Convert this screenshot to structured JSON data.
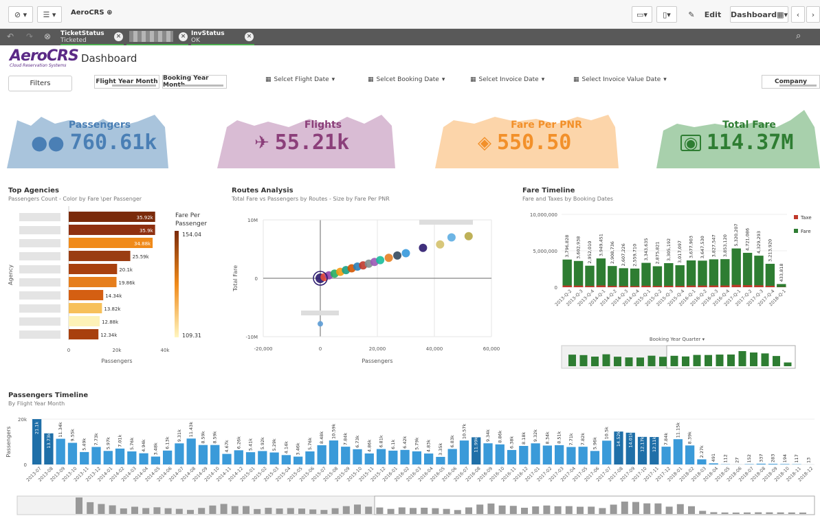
{
  "toolbar": {
    "app_name": "AeroCRS",
    "edit_label": "Edit",
    "sheet_label": "Dashboard"
  },
  "selections": [
    {
      "title": "TicketStatus",
      "value": "Ticketed"
    },
    {
      "title": "",
      "value": ""
    },
    {
      "title": "InvStatus",
      "value": "OK"
    }
  ],
  "header": {
    "logo_text": "AeroCRS",
    "logo_sub": "Cloud Reservation Systems",
    "title": "Dashboard",
    "filters_label": "Filters",
    "flight_year_month": "Flight Year Month",
    "booking_year_month": "Booking Year Month",
    "date_selectors": [
      "Selcet Flight Date",
      "Selcet Booking Date",
      "Selcet Invoice Date",
      "Select Invoice Value Date"
    ],
    "company_label": "Company"
  },
  "kpis": [
    {
      "label": "Passengers",
      "value": "760.61k",
      "icon": "people-icon",
      "color": "#4a7fb5",
      "fill": "#a9c4dc"
    },
    {
      "label": "Flights",
      "value": "55.21k",
      "icon": "plane-icon",
      "color": "#8b3f7a",
      "fill": "#d9bcd4"
    },
    {
      "label": "Fare Per PNR",
      "value": "550.50",
      "icon": "ticket-icon",
      "color": "#f2902a",
      "fill": "#fcd5aa"
    },
    {
      "label": "Total Fare",
      "value": "114.37M",
      "icon": "money-icon",
      "color": "#2e7d32",
      "fill": "#a8d0ac"
    }
  ],
  "top_agencies": {
    "title": "Top Agencies",
    "subtitle": "Passengers Count - Color by Fare \\per Passenger",
    "ylabel": "Agency",
    "xlabel": "Passengers",
    "legend_title": "Fare Per Passenger",
    "legend_max": "154.04",
    "legend_min": "109.31",
    "x_ticks": [
      "0",
      "20k",
      "40k"
    ],
    "bars": [
      {
        "label": "35.92k",
        "value": 35.92,
        "color": "#7a2a0a"
      },
      {
        "label": "35.9k",
        "value": 35.9,
        "color": "#8f3010"
      },
      {
        "label": "34.88k",
        "value": 34.88,
        "color": "#f08a1a"
      },
      {
        "label": "25.59k",
        "value": 25.59,
        "color": "#9a3d12"
      },
      {
        "label": "20.1k",
        "value": 20.1,
        "color": "#a8400e"
      },
      {
        "label": "19.86k",
        "value": 19.86,
        "color": "#e67e1c"
      },
      {
        "label": "14.34k",
        "value": 14.34,
        "color": "#d45f12"
      },
      {
        "label": "13.82k",
        "value": 13.82,
        "color": "#f7c05a"
      },
      {
        "label": "12.88k",
        "value": 12.88,
        "color": "#fdf2b8"
      },
      {
        "label": "12.34k",
        "value": 12.34,
        "color": "#a8400e"
      }
    ]
  },
  "routes": {
    "title": "Routes Analysis",
    "subtitle": "Total Fare vs Passengers by Routes - Size by Fare Per PNR",
    "ylabel": "Total Fare",
    "xlabel": "Passengers",
    "y_ticks": [
      "10M",
      "0",
      "-10M"
    ],
    "x_ticks": [
      "-20,000",
      "0",
      "20,000",
      "40,000",
      "60,000"
    ]
  },
  "fare_timeline": {
    "title": "Fare Timeline",
    "subtitle": "Fare and Taxes by Booking Dates",
    "legend": [
      "Taxe",
      "Fare"
    ],
    "y_ticks": [
      "10,000,000",
      "5,000,000",
      "0"
    ],
    "quarter_label": "Booking Year Quarter",
    "quarters": [
      "2013-Q-2",
      "2013-Q-3",
      "2013-Q-4",
      "2014-Q-1",
      "2014-Q-2",
      "2014-Q-3",
      "2014-Q-4",
      "2015-Q-1",
      "2015-Q-2",
      "2015-Q-3",
      "2015-Q-4",
      "2016-Q-1",
      "2016-Q-2",
      "2016-Q-3",
      "2016-Q-4",
      "2017-Q-1",
      "2017-Q-2",
      "2017-Q-3",
      "2017-Q-4",
      "2018-Q-1"
    ],
    "values": [
      3796828,
      3602938,
      2952010,
      3949451,
      2908736,
      2607226,
      2559710,
      3343635,
      2875821,
      3305192,
      3017097,
      3677903,
      3647530,
      3827547,
      3853120,
      5320207,
      4721086,
      4329293,
      3213920,
      433818
    ],
    "labels": [
      "3,796,828",
      "3,602,938",
      "2,952,010",
      "3,949,451",
      "2,908,736",
      "2,607,226",
      "2,559,710",
      "3,343,635",
      "2,875,821",
      "3,305,192",
      "3,017,097",
      "3,677,903",
      "3,647,530",
      "3,827,547",
      "3,853,120",
      "5,320,207",
      "4,721,086",
      "4,329,293",
      "3,213,920",
      "433,818"
    ]
  },
  "pax_timeline": {
    "title": "Passengers Timeline",
    "subtitle": "By Flight Year Month",
    "ylabel": "Passengers",
    "y_ticks": [
      "20k",
      "0"
    ],
    "months": [
      "2013-07",
      "2013-08",
      "2013-09",
      "2013-10",
      "2013-11",
      "2013-12",
      "2014-01",
      "2014-02",
      "2014-03",
      "2014-04",
      "2014-05",
      "2014-06",
      "2014-07",
      "2014-08",
      "2014-09",
      "2014-10",
      "2014-11",
      "2014-12",
      "2015-01",
      "2015-02",
      "2015-03",
      "2015-04",
      "2015-05",
      "2015-06",
      "2015-07",
      "2015-08",
      "2015-09",
      "2015-10",
      "2015-11",
      "2015-12",
      "2016-01",
      "2016-02",
      "2016-03",
      "2016-04",
      "2016-05",
      "2016-06",
      "2016-07",
      "2016-08",
      "2016-09",
      "2016-10",
      "2016-11",
      "2016-12",
      "2017-01",
      "2017-02",
      "2017-03",
      "2017-04",
      "2017-05",
      "2017-06",
      "2017-07",
      "2017-08",
      "2017-09",
      "2017-10",
      "2017-11",
      "2017-12",
      "2018-01",
      "2018-02",
      "2018-03",
      "2018-04",
      "2018-05",
      "2018-06",
      "2018-07",
      "2018-08",
      "2018-09",
      "2018-10",
      "2018-11",
      "2018-12"
    ],
    "labels": [
      "21.1k",
      "13.73k",
      "11.34k",
      "9.55k",
      "5.49k",
      "7.73k",
      "5.97k",
      "7.01k",
      "5.76k",
      "4.94k",
      "3.48k",
      "6.13k",
      "9.31k",
      "11.43k",
      "8.59k",
      "8.59k",
      "4.67k",
      "6.26k",
      "5.41k",
      "5.92k",
      "5.29k",
      "4.14k",
      "3.46k",
      "5.76k",
      "8.48k",
      "10.59k",
      "7.84k",
      "6.73k",
      "4.86k",
      "6.81k",
      "6.1k",
      "6.42k",
      "5.79k",
      "4.83k",
      "3.35k",
      "6.83k",
      "10.57k",
      "11.99k",
      "9.34k",
      "8.86k",
      "6.38k",
      "8.18k",
      "9.32k",
      "8.34k",
      "8.51k",
      "7.71k",
      "7.82k",
      "5.96k",
      "10.5k",
      "14.52k",
      "14.01k",
      "12.17k",
      "12.11k",
      "7.84k",
      "11.15k",
      "8.39k",
      "2.27k",
      "491",
      "112",
      "27",
      "152",
      "337",
      "283",
      "194",
      "117",
      "13"
    ],
    "values": [
      21.1,
      13.73,
      11.34,
      9.55,
      5.49,
      7.73,
      5.97,
      7.01,
      5.76,
      4.94,
      3.48,
      6.13,
      9.31,
      11.43,
      8.59,
      8.59,
      4.67,
      6.26,
      5.41,
      5.92,
      5.29,
      4.14,
      3.46,
      5.76,
      8.48,
      10.59,
      7.84,
      6.73,
      4.86,
      6.81,
      6.1,
      6.42,
      5.79,
      4.83,
      3.35,
      6.83,
      10.57,
      11.99,
      9.34,
      8.86,
      6.38,
      8.18,
      9.32,
      8.34,
      8.51,
      7.71,
      7.82,
      5.96,
      10.5,
      14.52,
      14.01,
      12.17,
      12.11,
      7.84,
      11.15,
      8.39,
      2.27,
      0.491,
      0.112,
      0.027,
      0.152,
      0.337,
      0.283,
      0.194,
      0.117,
      0.013
    ]
  },
  "chart_data": [
    {
      "type": "bar",
      "title": "Top Agencies",
      "xlabel": "Passengers",
      "ylabel": "Agency",
      "values": [
        35.92,
        35.9,
        34.88,
        25.59,
        20.1,
        19.86,
        14.34,
        13.82,
        12.88,
        12.34
      ],
      "units": "k",
      "xlim": [
        0,
        40
      ]
    },
    {
      "type": "bar",
      "title": "Fare Timeline",
      "categories": [
        "2013-Q-2",
        "2013-Q-3",
        "2013-Q-4",
        "2014-Q-1",
        "2014-Q-2",
        "2014-Q-3",
        "2014-Q-4",
        "2015-Q-1",
        "2015-Q-2",
        "2015-Q-3",
        "2015-Q-4",
        "2016-Q-1",
        "2016-Q-2",
        "2016-Q-3",
        "2016-Q-4",
        "2017-Q-1",
        "2017-Q-2",
        "2017-Q-3",
        "2017-Q-4",
        "2018-Q-1"
      ],
      "series": [
        {
          "name": "Fare",
          "values": [
            3796828,
            3602938,
            2952010,
            3949451,
            2908736,
            2607226,
            2559710,
            3343635,
            2875821,
            3305192,
            3017097,
            3677903,
            3647530,
            3827547,
            3853120,
            5320207,
            4721086,
            4329293,
            3213920,
            433818
          ]
        }
      ],
      "ylim": [
        0,
        10000000
      ]
    },
    {
      "type": "scatter",
      "title": "Routes Analysis",
      "xlabel": "Passengers",
      "ylabel": "Total Fare",
      "xlim": [
        -20000,
        60000
      ],
      "ylim": [
        -10000000,
        10000000
      ],
      "points": [
        [
          0,
          0
        ],
        [
          1500,
          200000
        ],
        [
          3000,
          500000
        ],
        [
          5000,
          800000
        ],
        [
          7000,
          1100000
        ],
        [
          9000,
          1400000
        ],
        [
          11000,
          1700000
        ],
        [
          13000,
          2000000
        ],
        [
          15000,
          2200000
        ],
        [
          17000,
          2500000
        ],
        [
          19000,
          2800000
        ],
        [
          21000,
          3100000
        ],
        [
          24000,
          3500000
        ],
        [
          27000,
          3900000
        ],
        [
          30000,
          4300000
        ],
        [
          36000,
          5200000
        ],
        [
          42000,
          5800000
        ],
        [
          46000,
          7000000
        ],
        [
          52000,
          7200000
        ],
        [
          0,
          -7800000
        ]
      ]
    }
  ]
}
